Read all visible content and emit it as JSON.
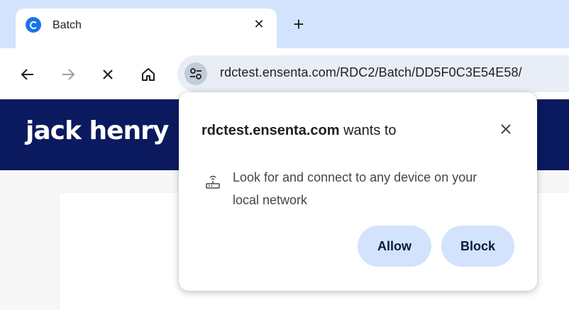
{
  "browser": {
    "tab": {
      "title": "Batch",
      "favicon": "ensenta-favicon-icon",
      "close_glyph": "✕"
    },
    "new_tab_glyph": "+",
    "toolbar": {
      "back_icon": "arrow-left-icon",
      "forward_icon": "arrow-right-icon",
      "stop_icon": "close-icon",
      "home_icon": "home-icon",
      "site_info_icon": "tune-icon"
    },
    "url": "rdctest.ensenta.com/RDC2/Batch/DD5F0C3E54E58/"
  },
  "page": {
    "logo_text": "jack henry",
    "header_color": "#0b1a5f"
  },
  "popup": {
    "host": "rdctest.ensenta.com",
    "title_suffix": " wants to",
    "permission_icon": "local-network-device-icon",
    "permission_text": "Look for and connect to any device on your local network",
    "allow_label": "Allow",
    "block_label": "Block",
    "button_color": "#d3e3fd"
  }
}
